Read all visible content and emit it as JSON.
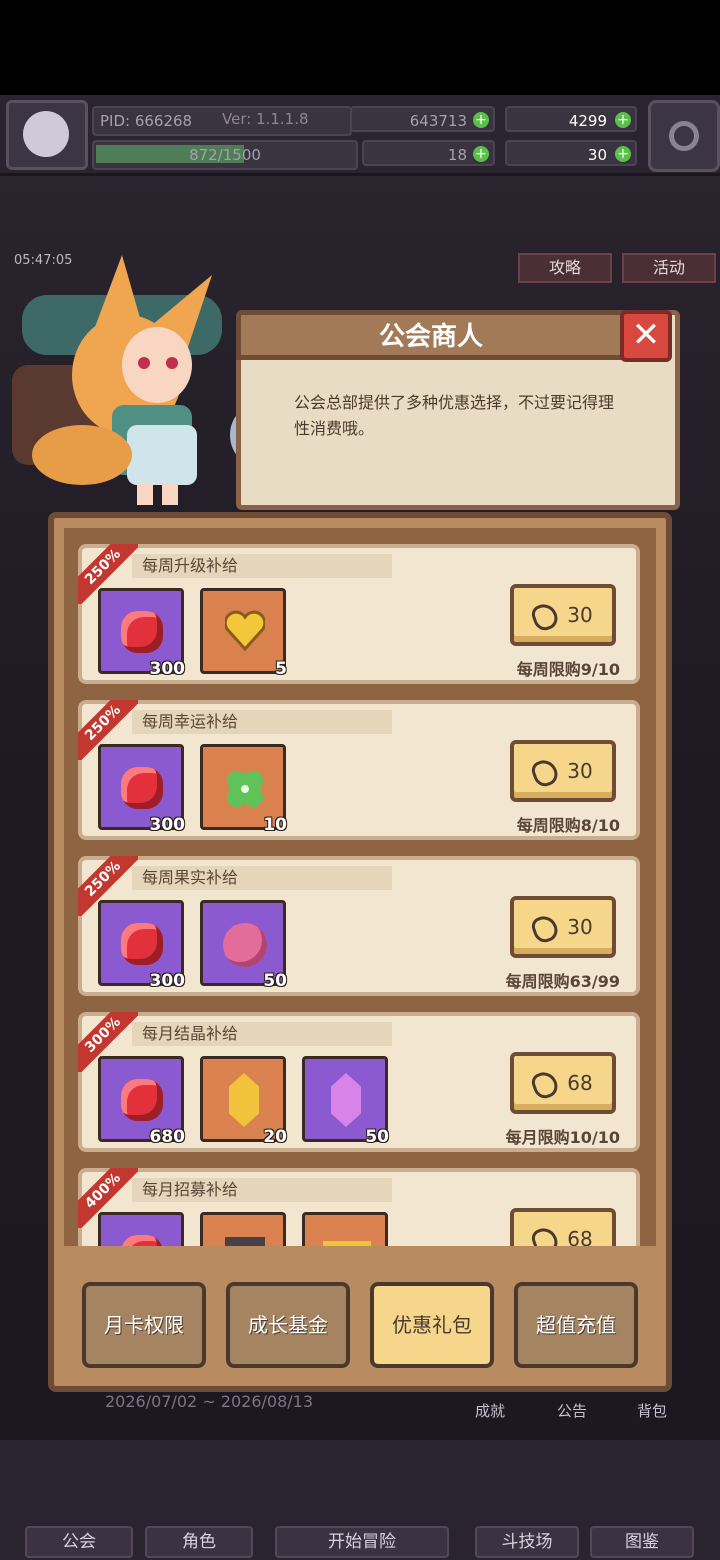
{
  "hud": {
    "pid": "PID: 666268",
    "version": "Ver: 1.1.1.8",
    "gold": "643713",
    "xp": "872/1500",
    "xp_progress": 0.58,
    "clover": "18",
    "gems": "4299",
    "coins": "30",
    "timer": "05:47:05",
    "side_btn_1": "攻略",
    "side_btn_2": "活动"
  },
  "merchant": {
    "title": "公会商人",
    "close": "✕",
    "description": "公会总部提供了多种优惠选择，不过要记得理性消费哦。"
  },
  "offers": [
    {
      "badge": "250%",
      "title": "每周升级补给",
      "price": "30",
      "limit": "每周限购9/10",
      "items": [
        {
          "icon": "ruby-icon",
          "qty": "300",
          "bg": "purple"
        },
        {
          "icon": "gold-heart-icon",
          "qty": "5",
          "bg": "orange"
        }
      ]
    },
    {
      "badge": "250%",
      "title": "每周幸运补给",
      "price": "30",
      "limit": "每周限购8/10",
      "items": [
        {
          "icon": "ruby-icon",
          "qty": "300",
          "bg": "purple"
        },
        {
          "icon": "clover-icon",
          "qty": "10",
          "bg": "orange"
        }
      ]
    },
    {
      "badge": "250%",
      "title": "每周果实补给",
      "price": "30",
      "limit": "每周限购63/99",
      "items": [
        {
          "icon": "ruby-icon",
          "qty": "300",
          "bg": "purple"
        },
        {
          "icon": "fruit-icon",
          "qty": "50",
          "bg": "purple"
        }
      ]
    },
    {
      "badge": "300%",
      "title": "每月结晶补给",
      "price": "68",
      "limit": "每月限购10/10",
      "items": [
        {
          "icon": "ruby-icon",
          "qty": "680",
          "bg": "purple"
        },
        {
          "icon": "gold-crystal-icon",
          "qty": "20",
          "bg": "orange"
        },
        {
          "icon": "pink-crystal-icon",
          "qty": "50",
          "bg": "purple"
        }
      ]
    },
    {
      "badge": "400%",
      "title": "每月招募补给",
      "price": "68",
      "limit": "",
      "items": [
        {
          "icon": "ruby-icon",
          "qty": "",
          "bg": "purple"
        },
        {
          "icon": "box-icon",
          "qty": "",
          "bg": "orange"
        },
        {
          "icon": "ticket-icon",
          "qty": "",
          "bg": "orange"
        }
      ]
    }
  ],
  "tabs": [
    "月卡权限",
    "成长基金",
    "优惠礼包",
    "超值充值"
  ],
  "active_tab": 2,
  "background": {
    "date_range": "2026/07/02 ~ 2026/08/13",
    "btn_achievement": "成就",
    "btn_notice": "公告",
    "btn_bag": "背包"
  },
  "nav": [
    "公会",
    "角色",
    "开始冒险",
    "斗技场",
    "图鉴"
  ]
}
